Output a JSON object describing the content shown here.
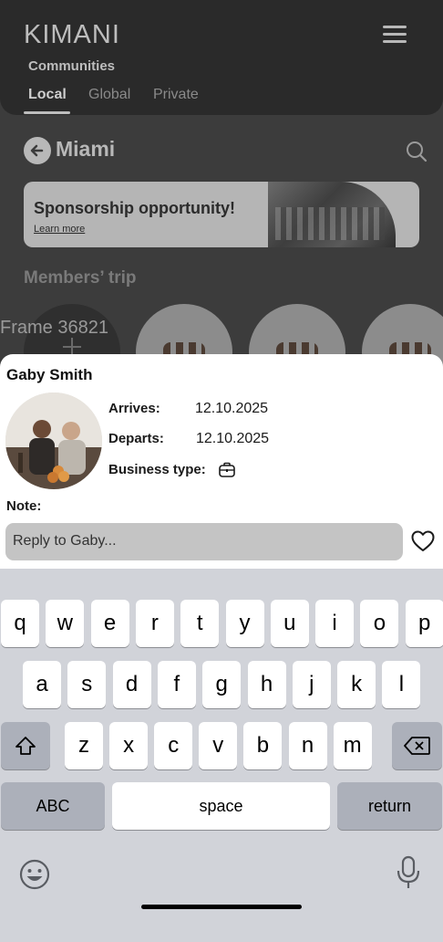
{
  "header": {
    "brand": "KIMANI",
    "section_title": "Communities",
    "tabs": [
      {
        "label": "Local",
        "active": true
      },
      {
        "label": "Global",
        "active": false
      },
      {
        "label": "Private",
        "active": false
      }
    ]
  },
  "community": {
    "city": "Miami"
  },
  "sponsor_banner": {
    "title": "Sponsorship opportunity!",
    "link": "Learn more"
  },
  "members_trip": {
    "title": "Members’ trip",
    "frame_label": "Frame 36821"
  },
  "member_sheet": {
    "name": "Gaby Smith",
    "arrives_label": "Arrives:",
    "arrives_value": "12.10.2025",
    "departs_label": "Departs:",
    "departs_value": "12.10.2025",
    "business_type_label": "Business type:",
    "note_label": "Note:",
    "reply_placeholder": "Reply to Gaby..."
  },
  "keyboard": {
    "row1": [
      "q",
      "w",
      "e",
      "r",
      "t",
      "y",
      "u",
      "i",
      "o",
      "p"
    ],
    "row2": [
      "a",
      "s",
      "d",
      "f",
      "g",
      "h",
      "j",
      "k",
      "l"
    ],
    "row3": [
      "z",
      "x",
      "c",
      "v",
      "b",
      "n",
      "m"
    ],
    "abc_label": "ABC",
    "space_label": "space",
    "return_label": "return"
  },
  "colors": {
    "overlay_bg": "#3c3c3c",
    "sheet_bg": "#ffffff",
    "input_bg": "#c4c4c4",
    "keyboard_bg": "#d1d3d9"
  }
}
